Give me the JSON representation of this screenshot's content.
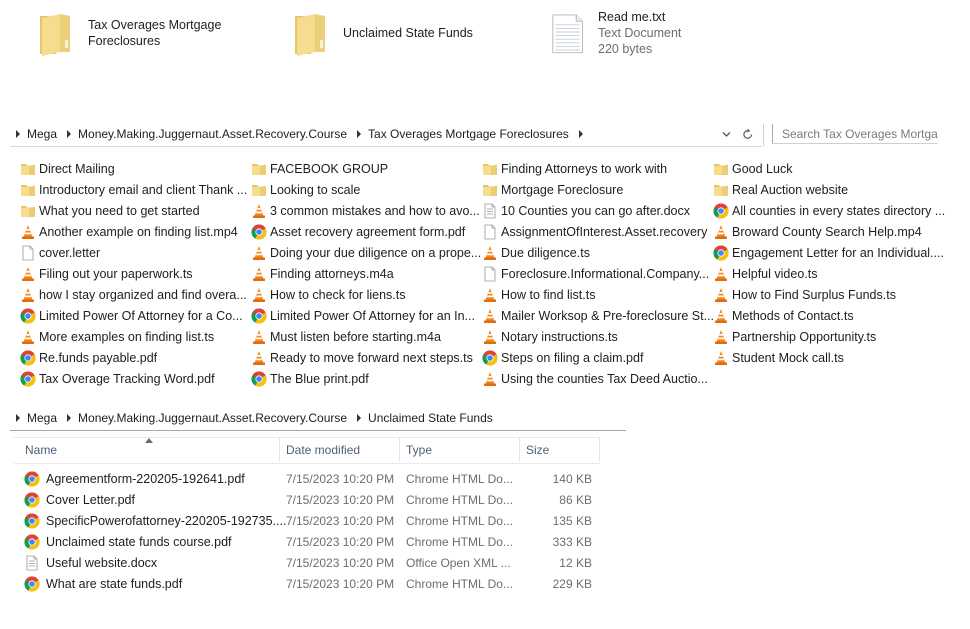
{
  "top_tiles": [
    {
      "name": "Tax Overages Mortgage",
      "name_line2": "Foreclosures",
      "icon": "folder-icon"
    },
    {
      "name": "Unclaimed State Funds",
      "icon": "folder-icon"
    },
    {
      "name": "Read me.txt",
      "type": "Text Document",
      "size": "220 bytes",
      "icon": "text-document-icon"
    }
  ],
  "address_bar_1": {
    "crumbs": [
      "Mega",
      "Money.Making.Juggernaut.Asset.Recovery.Course",
      "Tax Overages Mortgage Foreclosures"
    ],
    "dropdown_icon": "chevron-down-icon",
    "refresh_icon": "refresh-icon",
    "search_placeholder": "Search Tax Overages Mortgag"
  },
  "list_view": {
    "columns": [
      [
        {
          "label": "Direct Mailing",
          "icon": "folder"
        },
        {
          "label": "Introductory email and client Thank ...",
          "icon": "folder"
        },
        {
          "label": "What you need to get started",
          "icon": "folder"
        },
        {
          "label": "Another example on finding list.mp4",
          "icon": "vlc"
        },
        {
          "label": "cover.letter",
          "icon": "blank"
        },
        {
          "label": "Filing out your paperwork.ts",
          "icon": "vlc"
        },
        {
          "label": "how I stay organized and find overa...",
          "icon": "vlc"
        },
        {
          "label": "Limited Power Of Attorney for a Co...",
          "icon": "chrome"
        },
        {
          "label": "More examples on finding list.ts",
          "icon": "vlc"
        },
        {
          "label": "Re.funds payable.pdf",
          "icon": "chrome"
        },
        {
          "label": "Tax Overage Tracking Word.pdf",
          "icon": "chrome"
        }
      ],
      [
        {
          "label": "FACEBOOK GROUP",
          "icon": "folder"
        },
        {
          "label": "Looking to scale",
          "icon": "folder"
        },
        {
          "label": "3 common mistakes and how to avo...",
          "icon": "vlc"
        },
        {
          "label": "Asset recovery agreement form.pdf",
          "icon": "chrome"
        },
        {
          "label": "Doing your due diligence on a prope...",
          "icon": "vlc"
        },
        {
          "label": "Finding attorneys.m4a",
          "icon": "vlc"
        },
        {
          "label": "How to check for liens.ts",
          "icon": "vlc"
        },
        {
          "label": "Limited Power Of Attorney for an In...",
          "icon": "chrome"
        },
        {
          "label": "Must listen before starting.m4a",
          "icon": "vlc"
        },
        {
          "label": "Ready to move forward next steps.ts",
          "icon": "vlc"
        },
        {
          "label": "The Blue print.pdf",
          "icon": "chrome"
        }
      ],
      [
        {
          "label": "Finding Attorneys to work with",
          "icon": "folder"
        },
        {
          "label": "Mortgage Foreclosure",
          "icon": "folder"
        },
        {
          "label": "10 Counties you can go after.docx",
          "icon": "doc"
        },
        {
          "label": "AssignmentOfInterest.Asset.recovery",
          "icon": "blank"
        },
        {
          "label": "Due diligence.ts",
          "icon": "vlc"
        },
        {
          "label": "Foreclosure.Informational.Company...",
          "icon": "blank"
        },
        {
          "label": "How to find list.ts",
          "icon": "vlc"
        },
        {
          "label": "Mailer Worksop & Pre-foreclosure St...",
          "icon": "vlc"
        },
        {
          "label": "Notary instructions.ts",
          "icon": "vlc"
        },
        {
          "label": "Steps on filing a claim.pdf",
          "icon": "chrome"
        },
        {
          "label": "Using the counties Tax Deed Auctio...",
          "icon": "vlc"
        }
      ],
      [
        {
          "label": "Good Luck",
          "icon": "folder"
        },
        {
          "label": "Real Auction website",
          "icon": "folder"
        },
        {
          "label": "All counties in every states directory ...",
          "icon": "chrome"
        },
        {
          "label": "Broward County Search Help.mp4",
          "icon": "vlc"
        },
        {
          "label": "Engagement Letter for an Individual....",
          "icon": "chrome"
        },
        {
          "label": "Helpful video.ts",
          "icon": "vlc"
        },
        {
          "label": "How to Find Surplus Funds.ts",
          "icon": "vlc"
        },
        {
          "label": "Methods of Contact.ts",
          "icon": "vlc"
        },
        {
          "label": "Partnership Opportunity.ts",
          "icon": "vlc"
        },
        {
          "label": "Student Mock call.ts",
          "icon": "vlc"
        }
      ]
    ]
  },
  "address_bar_2": {
    "crumbs": [
      "Mega",
      "Money.Making.Juggernaut.Asset.Recovery.Course",
      "Unclaimed State Funds"
    ]
  },
  "details_view": {
    "headers": {
      "name": "Name",
      "date": "Date modified",
      "type": "Type",
      "size": "Size"
    },
    "sort_indicator": "sort-ascending-icon",
    "rows": [
      {
        "name": "Agreementform-220205-192641.pdf",
        "date": "7/15/2023 10:20 PM",
        "type": "Chrome HTML Do...",
        "size": "140 KB",
        "icon": "chrome"
      },
      {
        "name": "Cover Letter.pdf",
        "date": "7/15/2023 10:20 PM",
        "type": "Chrome HTML Do...",
        "size": "86 KB",
        "icon": "chrome"
      },
      {
        "name": "SpecificPowerofattorney-220205-192735....",
        "date": "7/15/2023 10:20 PM",
        "type": "Chrome HTML Do...",
        "size": "135 KB",
        "icon": "chrome"
      },
      {
        "name": "Unclaimed state funds course.pdf",
        "date": "7/15/2023 10:20 PM",
        "type": "Chrome HTML Do...",
        "size": "333 KB",
        "icon": "chrome"
      },
      {
        "name": "Useful website.docx",
        "date": "7/15/2023 10:20 PM",
        "type": "Office Open XML ...",
        "size": "12 KB",
        "icon": "doc"
      },
      {
        "name": "What are state funds.pdf",
        "date": "7/15/2023 10:20 PM",
        "type": "Chrome HTML Do...",
        "size": "229 KB",
        "icon": "chrome"
      }
    ]
  },
  "colors": {
    "folder": "#f3d77f",
    "folder_dark": "#dcb64e",
    "vlc_orange": "#f08a1c",
    "header_text": "#4c607a",
    "muted_text": "#6d6d6d"
  }
}
